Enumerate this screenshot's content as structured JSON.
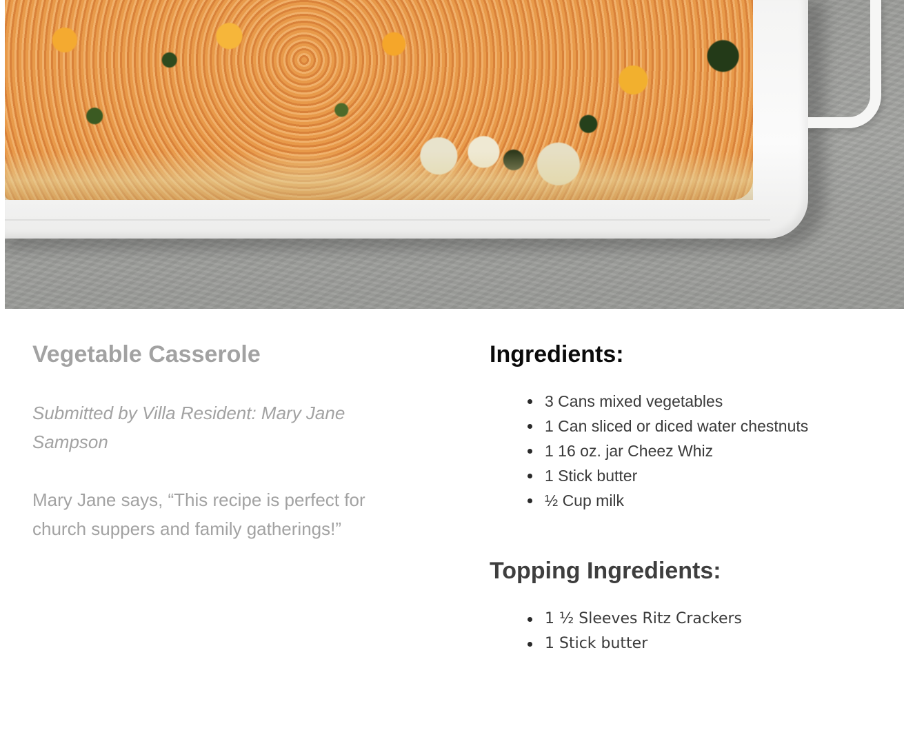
{
  "recipe": {
    "title": "Vegetable Casserole",
    "submitted_by": "Submitted by Villa Resident: Mary Jane Sampson",
    "quote": "Mary Jane says, “This recipe is perfect for church suppers and family gatherings!”"
  },
  "ingredients": {
    "heading": "Ingredients:",
    "items": [
      "3 Cans mixed vegetables",
      "1 Can sliced or diced water chestnuts",
      "1 16 oz. jar Cheez Whiz",
      "1 Stick butter",
      "½ Cup milk"
    ]
  },
  "topping": {
    "heading": "Topping Ingredients:",
    "items": [
      "1 ½ Sleeves Ritz Crackers",
      "1 Stick butter"
    ]
  },
  "colors": {
    "title_gray": "#a2a2a2",
    "heading_black": "#0a0a0a",
    "topping_heading": "#3e3e3e",
    "list_text": "#3a3a3a"
  }
}
